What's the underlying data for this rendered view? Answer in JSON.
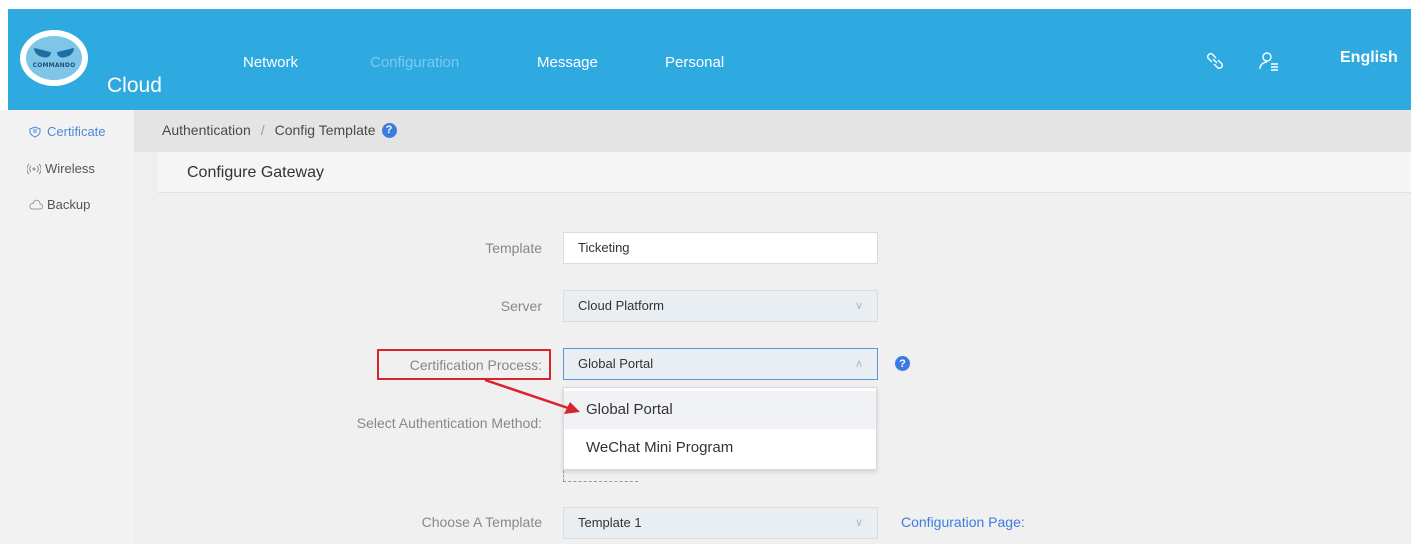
{
  "header": {
    "logo_text": "COMMANDO",
    "brand": "Cloud",
    "nav": [
      {
        "label": "Network"
      },
      {
        "label": "Configuration"
      },
      {
        "label": "Message"
      },
      {
        "label": "Personal"
      }
    ],
    "icons": [
      "link-icon",
      "user-menu-icon"
    ],
    "language": "English"
  },
  "sidebar": {
    "items": [
      {
        "label": "Certificate",
        "icon": "shield-icon",
        "active": true
      },
      {
        "label": "Wireless",
        "icon": "wireless-icon",
        "active": false
      },
      {
        "label": "Backup",
        "icon": "cloud-icon",
        "active": false
      }
    ]
  },
  "breadcrumb": {
    "items": [
      "Authentication",
      "Config Template"
    ],
    "separator": "/",
    "help": "?"
  },
  "panel": {
    "title": "Configure Gateway"
  },
  "form": {
    "template": {
      "label": "Template",
      "value": "Ticketing"
    },
    "server": {
      "label": "Server",
      "value": "Cloud Platform"
    },
    "cert_process": {
      "label": "Certification Process:",
      "value": "Global Portal",
      "help": "?"
    },
    "auth_method": {
      "label": "Select Authentication Method:"
    },
    "choose_template": {
      "label": "Choose A Template",
      "value": "Template 1",
      "link": "Configuration Page:"
    }
  },
  "dropdown": {
    "options": [
      "Global Portal",
      "WeChat Mini Program"
    ]
  },
  "colors": {
    "header_bg": "#2eaae1",
    "accent": "#3e7be0",
    "highlight": "#d9232d"
  }
}
